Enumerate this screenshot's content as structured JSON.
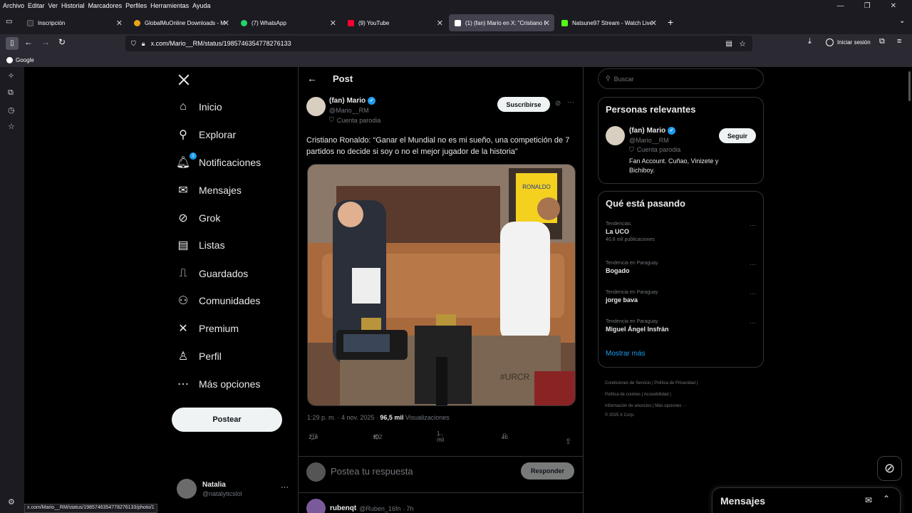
{
  "browser": {
    "menu": [
      "Archivo",
      "Editar",
      "Ver",
      "Historial",
      "Marcadores",
      "Perfiles",
      "Herramientas",
      "Ayuda"
    ],
    "tabs": [
      {
        "title": "Inscripción",
        "color": "#1f1f1f"
      },
      {
        "title": "GlobalMuOnline Downloads - M",
        "color": "#e8a317"
      },
      {
        "title": "(7) WhatsApp",
        "color": "#25d366"
      },
      {
        "title": "(9) YouTube",
        "color": "#ff0033"
      },
      {
        "title": "(1) (fan) Mario en X: \"Cristiano I",
        "color": "#ffffff"
      },
      {
        "title": "Natsune97 Stream - Watch Live",
        "color": "#53fc18"
      }
    ],
    "url": "x.com/Mario__RM/status/1985746354778276133",
    "signin_label": "Iniciar sesión",
    "bookmark_label": "Google",
    "status_url": "x.com/Mario__RM/status/1985746354778276133/photo/1"
  },
  "nav": {
    "items": [
      "Inicio",
      "Explorar",
      "Notificaciones",
      "Mensajes",
      "Grok",
      "Listas",
      "Guardados",
      "Comunidades",
      "Premium",
      "Perfil",
      "Más opciones"
    ],
    "notif_badge": "1",
    "post_button": "Postear",
    "user_name": "Natalia",
    "user_handle": "@natalyticslol"
  },
  "post": {
    "header_title": "Post",
    "author_name": "(fan) Mario",
    "author_handle": "@Mario__RM",
    "author_label": "Cuenta parodia",
    "subscribe_label": "Suscribirse",
    "text": "Cristiano Ronaldo: “Ganar el Mundial no es mi sueño, una competición de 7 partidos no decide si soy o no el mejor jugador de la historia”",
    "time": "1:29 p. m. · 4 nov. 2025 · ",
    "views": "96,5 mil",
    "views_label": " Visualizaciones",
    "replies": "216",
    "reposts": "102",
    "likes": "1 mil",
    "bookmarks": "46",
    "reply_placeholder": "Postea tu respuesta",
    "reply_button": "Responder",
    "media_text_jersey": "RONALDO",
    "media_text_table": "#URCR",
    "next_reply": {
      "name": "rubenqt",
      "handle": "@Ruben_16fn · 7h"
    }
  },
  "right": {
    "search_placeholder": "Buscar",
    "people_title": "Personas relevantes",
    "person": {
      "name": "(fan) Mario",
      "handle": "@Mario__RM",
      "label": "Cuenta parodia",
      "bio": "Fan Account. Cuñao, Vinizete y Bichiboy.",
      "follow": "Seguir"
    },
    "trends_title": "Qué está pasando",
    "trends": [
      {
        "category": "Tendencias",
        "name": "La UCO",
        "count": "40,8 mil publicaciones"
      },
      {
        "category": "Tendencia en Paraguay",
        "name": "Bogado",
        "count": ""
      },
      {
        "category": "Tendencia en Paraguay",
        "name": "jorge bava",
        "count": ""
      },
      {
        "category": "Tendencia en Paraguay",
        "name": "Miguel Ángel Insfrán",
        "count": ""
      }
    ],
    "show_more": "Mostrar más",
    "footer": {
      "line1": "Condiciones de Servicio  |  Política de Privacidad  |",
      "line2": "Política de cookies  |  Accesibilidad  |",
      "line3": "Información de anuncios  |  Más opciones ···",
      "line4": "© 2025 X Corp."
    },
    "messages_label": "Mensajes"
  },
  "colors": {
    "accent": "#1d9bf0",
    "background": "#000000",
    "border": "#2f3336"
  }
}
